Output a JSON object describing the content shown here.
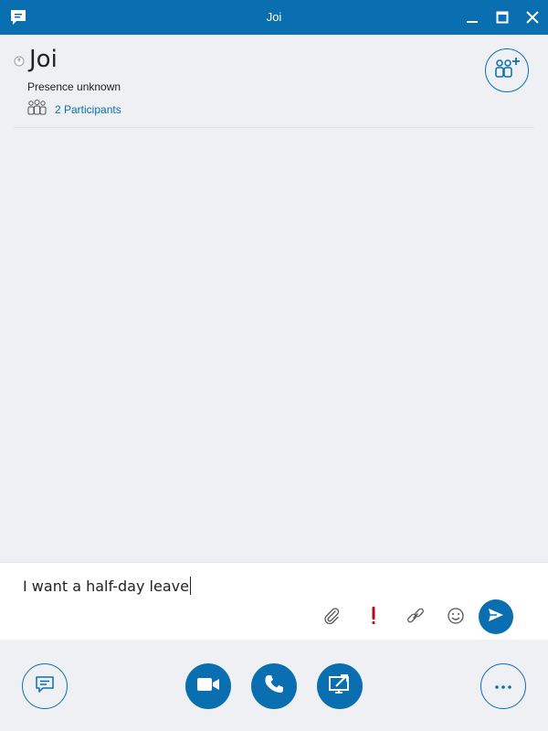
{
  "window": {
    "title": "Joi",
    "icons": {
      "app": "chat-bubble-icon",
      "minimize": "minimize-icon",
      "maximize": "maximize-icon",
      "close": "close-icon"
    }
  },
  "header": {
    "contact_name": "Joi",
    "presence": "Presence unknown",
    "participants_label": "2 Participants",
    "icons": {
      "presence": "presence-unknown-icon",
      "participants": "participants-icon",
      "add_people": "add-people-icon"
    }
  },
  "compose": {
    "text": "I want a half-day leave",
    "tools": [
      "attach-file-icon",
      "high-importance-icon",
      "link-icon",
      "emoji-icon",
      "send-icon"
    ]
  },
  "bottombar": {
    "buttons": [
      "im-icon",
      "video-call-icon",
      "phone-call-icon",
      "present-screen-icon",
      "more-options-icon"
    ]
  },
  "colors": {
    "accent": "#0a6fb0",
    "importance": "#c4001e",
    "background": "#eef0f4"
  }
}
